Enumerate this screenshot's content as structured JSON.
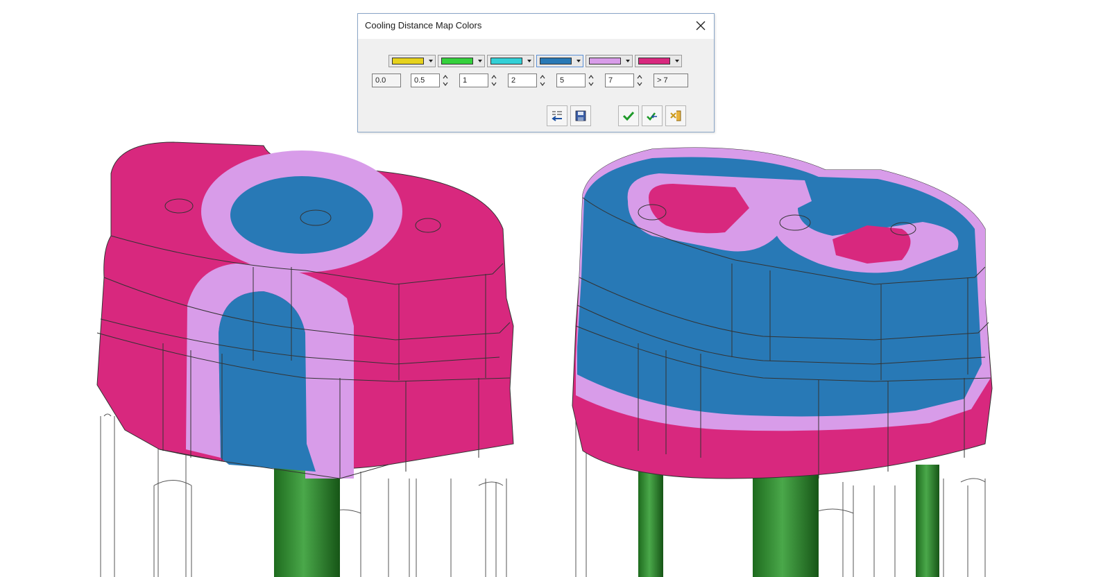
{
  "dialog": {
    "title": "Cooling Distance Map Colors",
    "swatches": [
      {
        "color": "#e6d21d"
      },
      {
        "color": "#35d13d"
      },
      {
        "color": "#33d0d6"
      },
      {
        "color": "#2879b6"
      },
      {
        "color": "#d89ce9"
      },
      {
        "color": "#d8287e"
      }
    ],
    "values": [
      "0.0",
      "0.5",
      "1",
      "2",
      "5",
      "7",
      "> 7"
    ],
    "buttons": {
      "load_icon": "load-settings-icon",
      "save_icon": "save-icon",
      "ok_icon": "checkmark-icon",
      "apply_icon": "apply-icon",
      "exit_icon": "exit-icon"
    }
  },
  "colors": {
    "magenta": "#d8287e",
    "blue": "#2879b6",
    "lilac": "#d89ce9",
    "pipe_green": "#2e8b2e",
    "edge": "#333333"
  }
}
